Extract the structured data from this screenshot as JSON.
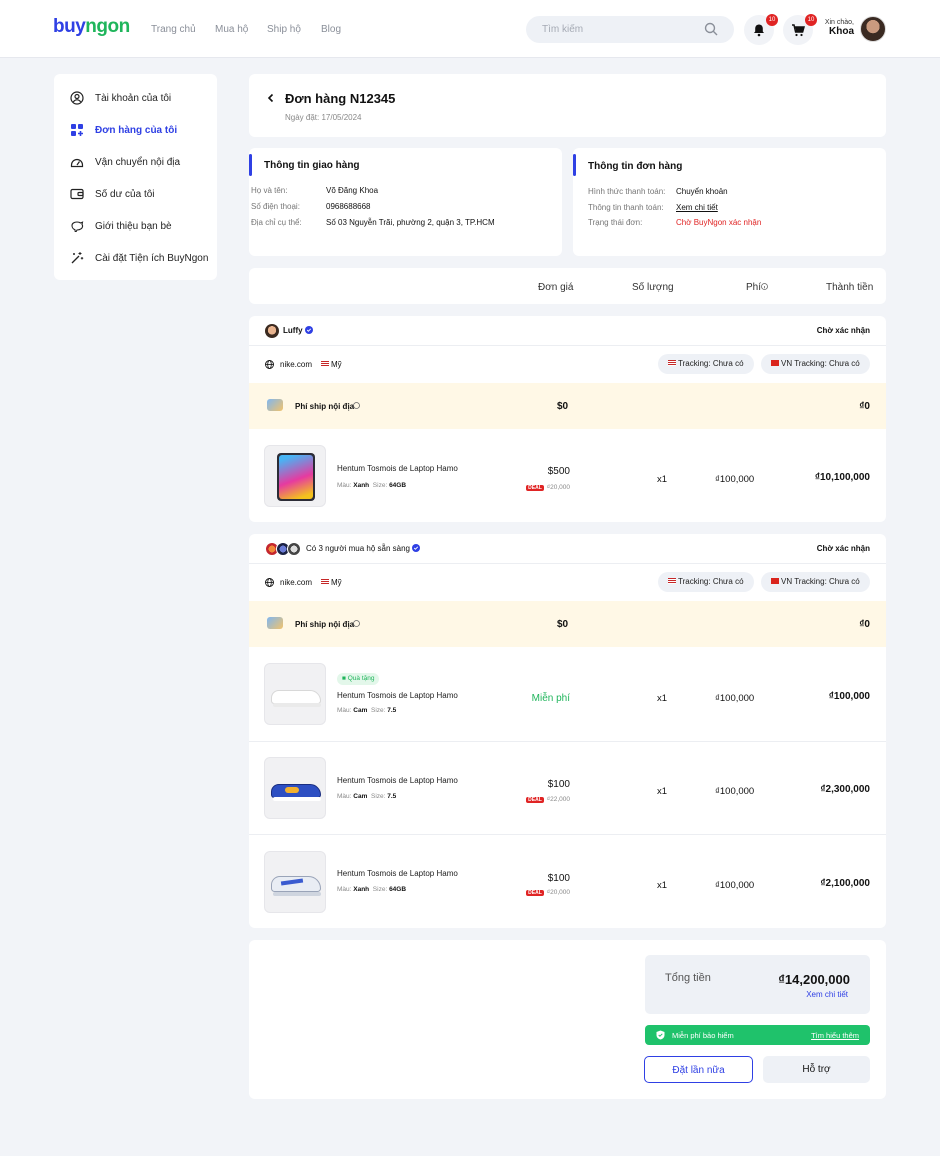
{
  "header": {
    "logo_prefix": "buy",
    "logo_suffix": "ngon",
    "nav": [
      "Trang chủ",
      "Mua hộ",
      "Ship hộ",
      "Blog"
    ],
    "search_placeholder": "Tìm kiếm",
    "notif_count": "10",
    "cart_count": "10",
    "greeting": "Xin chào,",
    "user_name": "Khoa"
  },
  "sidebar": {
    "items": [
      {
        "label": "Tài khoản của tôi",
        "icon": "user-circle-icon"
      },
      {
        "label": "Đơn hàng của tôi",
        "icon": "grid-plus-icon"
      },
      {
        "label": "Vận chuyển nội địa",
        "icon": "gauge-icon"
      },
      {
        "label": "Số dư của tôi",
        "icon": "wallet-icon"
      },
      {
        "label": "Giới thiệu bạn bè",
        "icon": "piggy-bank-icon"
      },
      {
        "label": "Cài đặt Tiện ích BuyNgon",
        "icon": "magic-wand-icon"
      }
    ]
  },
  "order": {
    "title": "Đơn hàng N12345",
    "date": "Ngày đặt: 17/05/2024"
  },
  "shipping": {
    "title": "Thông tin giao hàng",
    "name_label": "Họ và tên:",
    "name": "Võ Đăng Khoa",
    "phone_label": "Số điện thoại:",
    "phone": "0968688668",
    "address_label": "Địa chỉ cụ thể:",
    "address": "Số 03 Nguyễn Trãi, phường 2, quận 3, TP.HCM"
  },
  "orderinfo": {
    "title": "Thông tin đơn hàng",
    "method_label": "Hình thức thanh toán:",
    "method": "Chuyển khoản",
    "payinfo_label": "Thông tin thanh toán:",
    "payinfo": "Xem chi tiết",
    "status_label": "Trạng thái đơn:",
    "status": "Chờ BuyNgon xác nhận"
  },
  "columns": {
    "price": "Đơn giá",
    "qty": "Số lượng",
    "fee": "Phí",
    "total": "Thành tiền"
  },
  "group1": {
    "seller": "Luffy",
    "status": "Chờ xác nhận",
    "store": "nike.com",
    "country": "Mỹ",
    "us_tracking": "Tracking: Chưa có",
    "vn_tracking": "VN Tracking: Chưa có",
    "ship_label": "Phí ship nội địa",
    "ship_price": "$0",
    "ship_total": "₫0",
    "items": [
      {
        "name": "Hentum Tosmois de Laptop Hamo",
        "color_label": "Màu:",
        "color": "Xanh",
        "size_label": "Size:",
        "size": "64GB",
        "price": "$500",
        "deal": "DEAL",
        "deal_price": "₫20,000",
        "qty": "x1",
        "fee": "₫100,000",
        "total": "₫10,100,000"
      }
    ]
  },
  "group2": {
    "seller": "Có 3 người mua hộ sẵn sàng",
    "status": "Chờ xác nhận",
    "store": "nike.com",
    "country": "Mỹ",
    "us_tracking": "Tracking: Chưa có",
    "vn_tracking": "VN Tracking: Chưa có",
    "ship_label": "Phí ship nội địa",
    "ship_price": "$0",
    "ship_total": "₫0",
    "gift": "Quà tặng",
    "free": "Miễn phí",
    "items": [
      {
        "name": "Hentum Tosmois de Laptop Hamo",
        "color_label": "Màu:",
        "color": "Cam",
        "size_label": "Size:",
        "size": "7.5",
        "qty": "x1",
        "fee": "₫100,000",
        "total": "₫100,000"
      },
      {
        "name": "Hentum Tosmois de Laptop Hamo",
        "color_label": "Màu:",
        "color": "Cam",
        "size_label": "Size:",
        "size": "7.5",
        "price": "$100",
        "deal": "DEAL",
        "deal_price": "₫22,000",
        "qty": "x1",
        "fee": "₫100,000",
        "total": "₫2,300,000"
      },
      {
        "name": "Hentum Tosmois de Laptop Hamo",
        "color_label": "Màu:",
        "color": "Xanh",
        "size_label": "Size:",
        "size": "64GB",
        "price": "$100",
        "deal": "DEAL",
        "deal_price": "₫20,000",
        "qty": "x1",
        "fee": "₫100,000",
        "total": "₫2,100,000"
      }
    ]
  },
  "summary": {
    "total_label": "Tổng tiền",
    "total": "₫14,200,000",
    "detail": "Xem chi tiết",
    "insurance": "Miễn phí bảo hiểm",
    "learn_more": "Tìm hiểu thêm",
    "reorder": "Đặt lần nữa",
    "support": "Hỗ trợ"
  },
  "colors": {
    "accent": "#2f40e4",
    "green": "#1fb55b",
    "red": "#e02424",
    "yellow_bg": "#fff8e6"
  }
}
